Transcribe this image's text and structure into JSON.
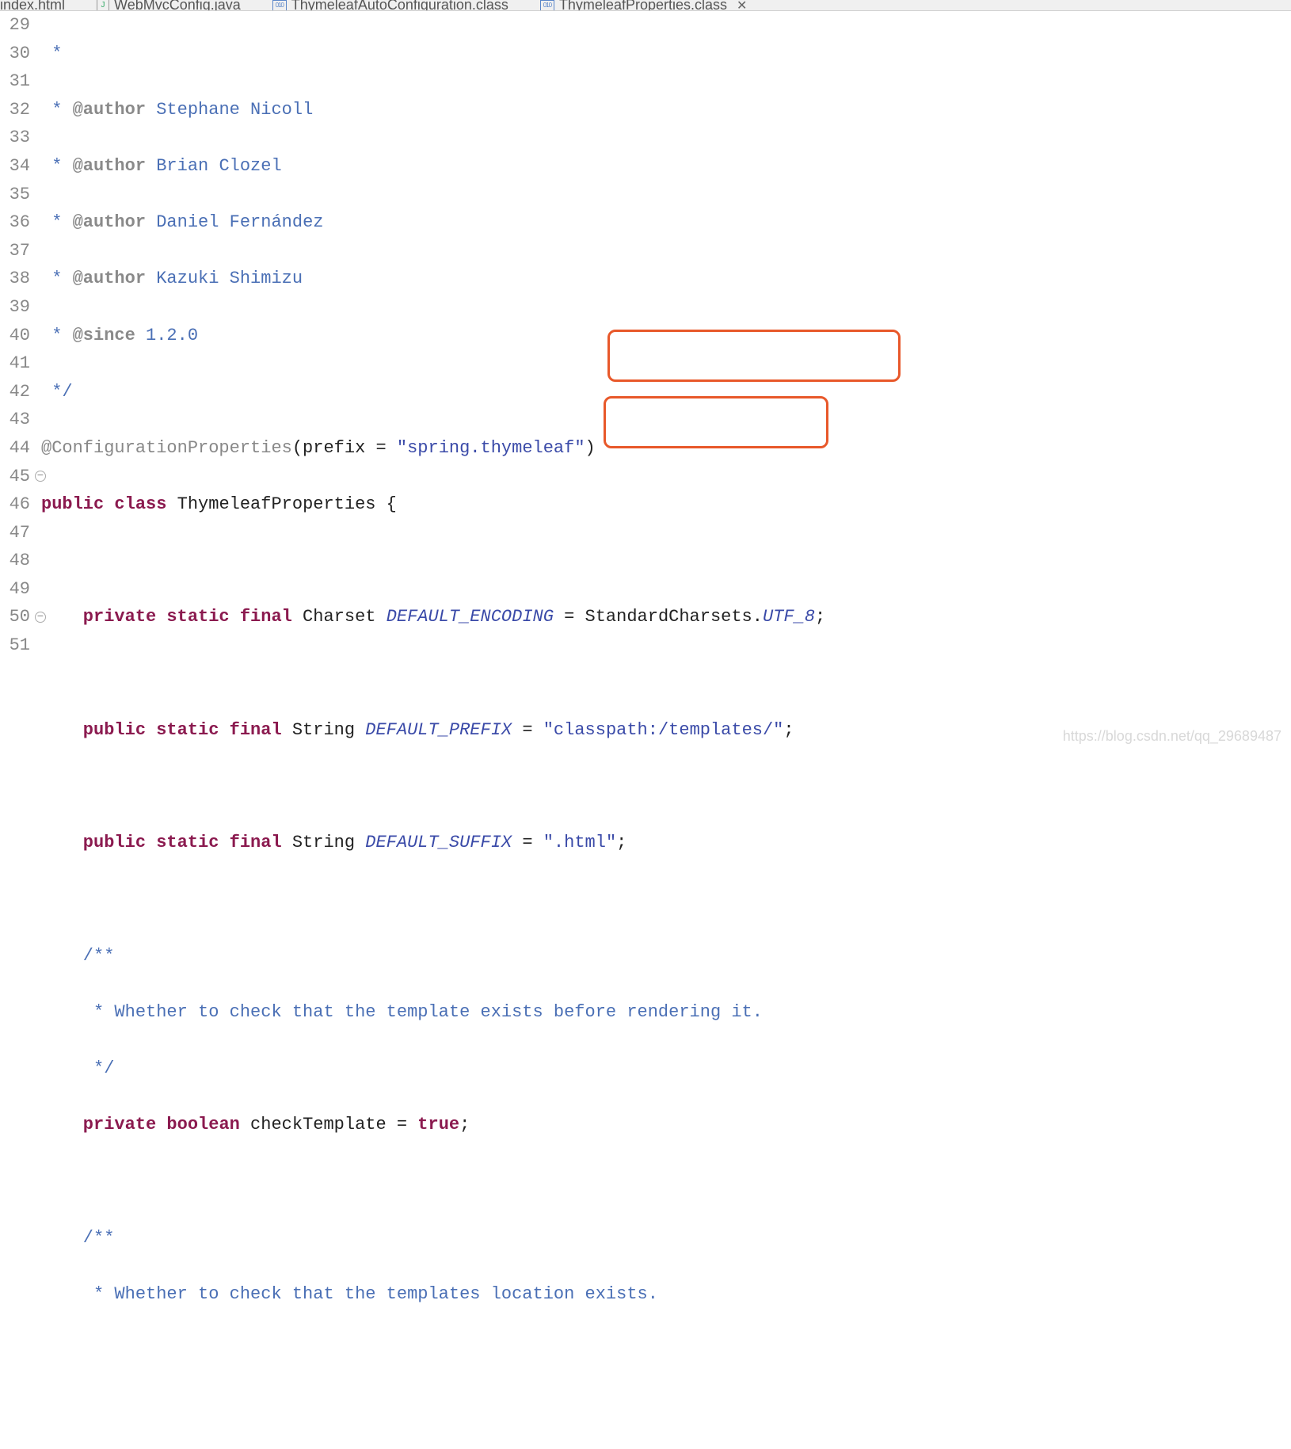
{
  "tabs": {
    "items": [
      {
        "label": "index.html",
        "iconType": "none"
      },
      {
        "label": "WebMvcConfig.java",
        "iconType": "j"
      },
      {
        "label": "ThymeleafAutoConfiguration.class",
        "iconType": "c"
      },
      {
        "label": "ThymeleafProperties.class",
        "iconType": "c",
        "active": true
      }
    ],
    "closeGlyph": "✕"
  },
  "gutter": {
    "start": 29,
    "end": 51,
    "foldLines": [
      45,
      50
    ]
  },
  "code": {
    "l29": " *",
    "l30_pre": " * ",
    "l30_tag": "@author",
    "l30_name": " Stephane Nicoll",
    "l31_pre": " * ",
    "l31_tag": "@author",
    "l31_name": " Brian Clozel",
    "l32_pre": " * ",
    "l32_tag": "@author",
    "l32_name": " Daniel Fernández",
    "l33_pre": " * ",
    "l33_tag": "@author",
    "l33_name": " Kazuki Shimizu",
    "l34_pre": " * ",
    "l34_tag": "@since",
    "l34_ver": " 1.2.0",
    "l35": " */",
    "l36_ann": "@ConfigurationProperties",
    "l36_p1": "(prefix = ",
    "l36_str": "\"spring.thymeleaf\"",
    "l36_p2": ")",
    "l37_kw1": "public",
    "l37_kw2": " class",
    "l37_name": " ThymeleafProperties {",
    "l39_kw": "    private static final",
    "l39_type": " Charset ",
    "l39_field": "DEFAULT_ENCODING",
    "l39_eq": " = StandardCharsets.",
    "l39_val": "UTF_8",
    "l39_semi": ";",
    "l41_kw": "    public static final",
    "l41_type": " String ",
    "l41_field": "DEFAULT_PREFIX",
    "l41_eq": " = ",
    "l41_str": "\"classpath:/templates/\"",
    "l41_semi": ";",
    "l43_kw": "    public static final",
    "l43_type": " String ",
    "l43_field": "DEFAULT_SUFFIX",
    "l43_eq": " = ",
    "l43_str": "\".html\"",
    "l43_semi": ";",
    "l45": "    /**",
    "l46": "     * Whether to check that the template exists before rendering it.",
    "l47": "     */",
    "l48_kw": "    private",
    "l48_type": " boolean",
    "l48_name": " checkTemplate = ",
    "l48_val": "true",
    "l48_semi": ";",
    "l50": "    /**",
    "l51": "     * Whether to check that the templates location exists."
  },
  "watermark": "https://blog.csdn.net/qq_29689487"
}
